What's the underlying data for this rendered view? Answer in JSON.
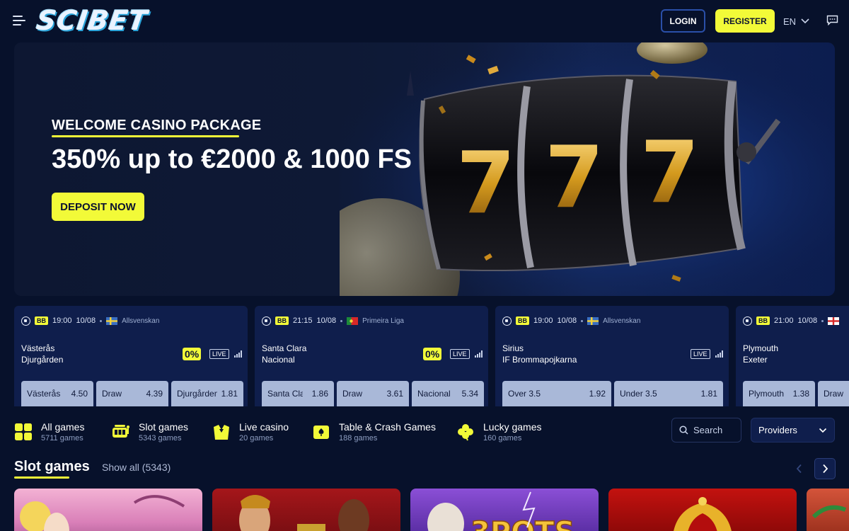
{
  "header": {
    "logo": "SCIBET",
    "login_label": "LOGIN",
    "register_label": "REGISTER",
    "language": "EN"
  },
  "hero": {
    "subtitle": "WELCOME CASINO PACKAGE",
    "title": "350% up to €2000 & 1000 FS",
    "cta_label": "DEPOSIT NOW",
    "reel_symbol": "7"
  },
  "matches": [
    {
      "badge": "BB",
      "time": "19:00",
      "date": "10/08",
      "league": "Allsvenskan",
      "flag": "sweden",
      "home": "Västerås",
      "away": "Djurgården",
      "boost": "0%",
      "live": "LIVE",
      "odds": [
        {
          "label": "Västerås",
          "value": "4.50"
        },
        {
          "label": "Draw",
          "value": "4.39"
        },
        {
          "label": "Djurgården",
          "value": "1.81"
        }
      ]
    },
    {
      "badge": "BB",
      "time": "21:15",
      "date": "10/08",
      "league": "Primeira Liga",
      "flag": "portugal",
      "home": "Santa Clara",
      "away": "Nacional",
      "boost": "0%",
      "live": "LIVE",
      "odds": [
        {
          "label": "Santa Clara",
          "value": "1.86"
        },
        {
          "label": "Draw",
          "value": "3.61"
        },
        {
          "label": "Nacional",
          "value": "5.34"
        }
      ]
    },
    {
      "badge": "BB",
      "time": "19:00",
      "date": "10/08",
      "league": "Allsvenskan",
      "flag": "sweden",
      "home": "Sirius",
      "away": "IF Brommapojkarna",
      "boost": "",
      "live": "LIVE",
      "odds": [
        {
          "label": "Over 3.5",
          "value": "1.92"
        },
        {
          "label": "Under 3.5",
          "value": "1.81"
        }
      ]
    },
    {
      "badge": "BB",
      "time": "21:00",
      "date": "10/08",
      "league": "",
      "flag": "england",
      "home": "Plymouth",
      "away": "Exeter",
      "boost": "",
      "live": "",
      "odds": [
        {
          "label": "Plymouth",
          "value": "1.38"
        },
        {
          "label": "Draw",
          "value": ""
        }
      ]
    }
  ],
  "categories": [
    {
      "name": "All games",
      "count": "5711 games",
      "icon": "grid-icon"
    },
    {
      "name": "Slot games",
      "count": "5343 games",
      "icon": "slot-machine-icon"
    },
    {
      "name": "Live casino",
      "count": "20 games",
      "icon": "dealer-icon"
    },
    {
      "name": "Table & Crash Games",
      "count": "188 games",
      "icon": "cards-icon"
    },
    {
      "name": "Lucky games",
      "count": "160 games",
      "icon": "clover-icon"
    }
  ],
  "search": {
    "placeholder": "Search"
  },
  "providers": {
    "label": "Providers"
  },
  "slot_section": {
    "title": "Slot games",
    "show_all": "Show all (5343)"
  },
  "colors": {
    "background": "#07112b",
    "accent": "#f2fa38",
    "card": "#0f1e4c",
    "odd_button": "#a9b8d8"
  }
}
